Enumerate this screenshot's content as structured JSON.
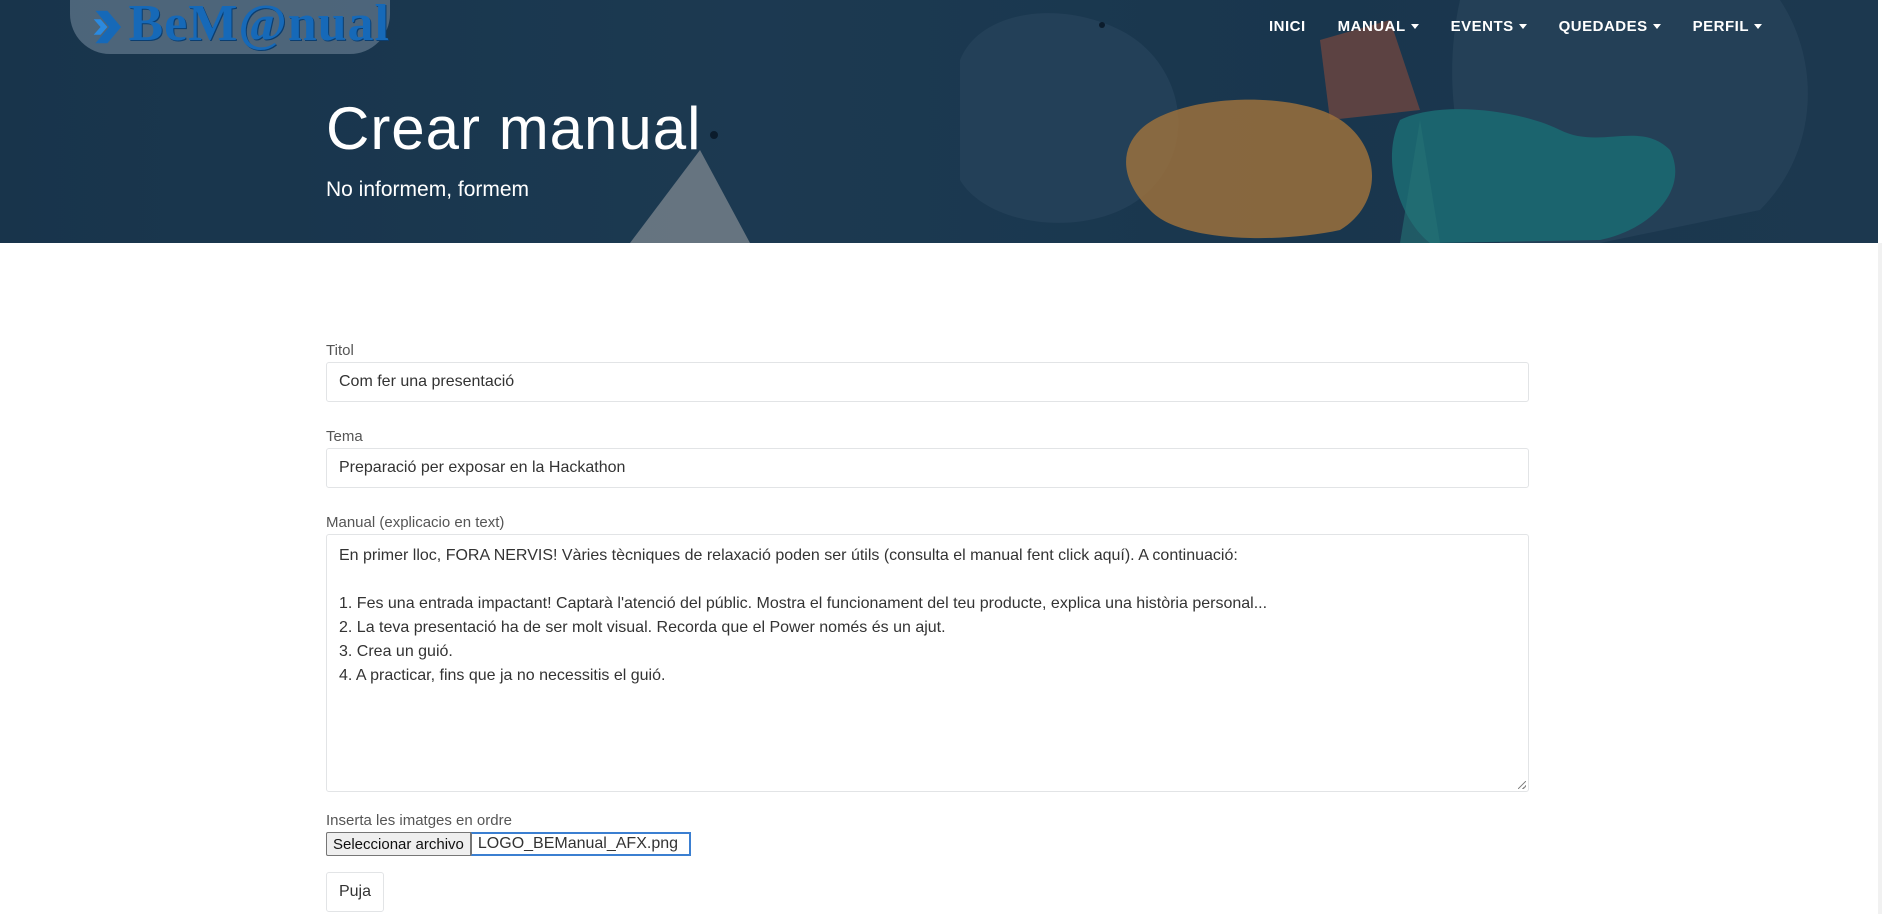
{
  "header": {
    "logo_text": "BeM@nual",
    "nav": [
      {
        "label": "INICI",
        "dropdown": false
      },
      {
        "label": "MANUAL",
        "dropdown": true
      },
      {
        "label": "EVENTS",
        "dropdown": true
      },
      {
        "label": "QUEDADES",
        "dropdown": true
      },
      {
        "label": "PERFIL",
        "dropdown": true
      }
    ],
    "title": "Crear manual",
    "subtitle": "No informem, formem"
  },
  "form": {
    "titol": {
      "label": "Titol",
      "value": "Com fer una presentació"
    },
    "tema": {
      "label": "Tema",
      "value": "Preparació per exposar en la Hackathon"
    },
    "manual": {
      "label": "Manual (explicacio en text)",
      "lines": [
        "En primer lloc, FORA NERVIS! Vàries tècniques de relaxació poden ser útils (consulta el manual fent click aquí). A continuació:",
        "",
        "1. Fes una entrada impactant! Captarà l'atenció del públic. Mostra el funcionament del teu producte, explica una història personal...",
        "2. La teva presentació ha de ser molt visual. Recorda que el Power només és un ajut.",
        "3. Crea un guió.",
        "4. A practicar, fins que ja no necessitis el guió."
      ]
    },
    "images": {
      "label": "Inserta les imatges en ordre",
      "button_label": "Seleccionar archivo",
      "file_name": "LOGO_BEManual_AFX.png"
    },
    "upload_label": "Puja"
  },
  "colors": {
    "hero_bg": "#1d3d55",
    "logo_blue": "#1669b8",
    "file_focus": "#3b7fd1"
  }
}
